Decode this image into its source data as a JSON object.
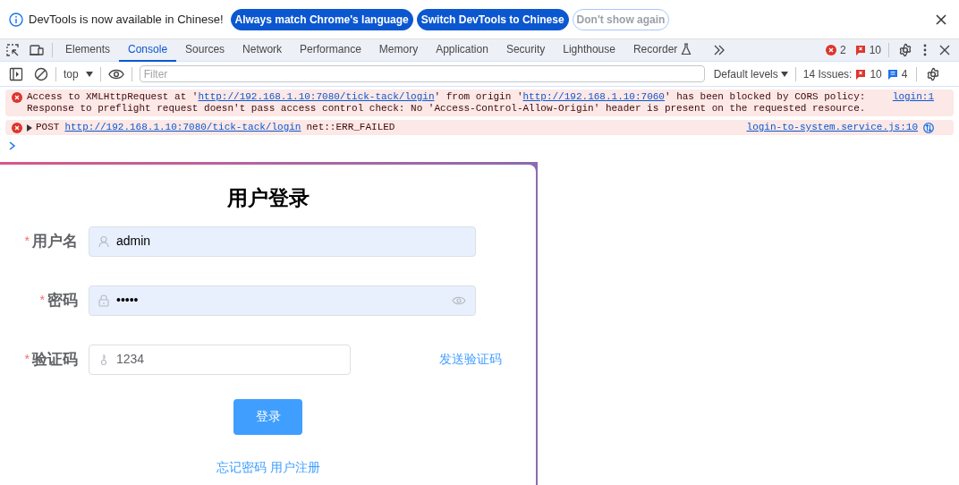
{
  "infobar": {
    "message": "DevTools is now available in Chinese!",
    "buttons": [
      {
        "label": "Always match Chrome's language",
        "kind": "primary"
      },
      {
        "label": "Switch DevTools to Chinese",
        "kind": "primary"
      },
      {
        "label": "Don't show again",
        "kind": "outline"
      }
    ]
  },
  "tabs": [
    {
      "label": "Elements",
      "selected": false
    },
    {
      "label": "Console",
      "selected": true
    },
    {
      "label": "Sources",
      "selected": false
    },
    {
      "label": "Network",
      "selected": false
    },
    {
      "label": "Performance",
      "selected": false
    },
    {
      "label": "Memory",
      "selected": false
    },
    {
      "label": "Application",
      "selected": false
    },
    {
      "label": "Security",
      "selected": false
    },
    {
      "label": "Lighthouse",
      "selected": false
    },
    {
      "label": "Recorder",
      "selected": false,
      "experimental": true
    }
  ],
  "error_count": "2",
  "issue_count": "10",
  "console_toolbar": {
    "context": "top",
    "filter_placeholder": "Filter",
    "levels": "Default levels",
    "issues_label": "14 Issues:",
    "issues_errors": "10",
    "issues_info": "4"
  },
  "messages": [
    {
      "kind": "cors",
      "lines": [
        [
          {
            "text": "Access to XMLHttpRequest at '"
          },
          {
            "text": "http://192.168.1.10:7080/tick-tack/login",
            "link": true
          },
          {
            "text": "' from origin '"
          },
          {
            "text": "http://192.168.1.10:7060",
            "link": true
          },
          {
            "text": "' has been blocked by CORS policy:"
          }
        ],
        [
          {
            "text": "Response to preflight request doesn't pass access control check: No 'Access-Control-Allow-Origin' header is present on the requested resource."
          }
        ]
      ],
      "source": "login:1"
    },
    {
      "kind": "request",
      "expanded": false,
      "method": "POST",
      "url": "http://192.168.1.10:7080/tick-tack/login",
      "status": "net::ERR_FAILED",
      "source": "login-to-system.service.js:10"
    }
  ],
  "login": {
    "title": "用户登录",
    "fields": [
      {
        "kind": "user",
        "label": "用户名",
        "required_mark": "*",
        "value": "admin",
        "autofilled": true
      },
      {
        "kind": "password",
        "label": "密码",
        "required_mark": "*",
        "value": "•••••",
        "autofilled": true
      },
      {
        "kind": "code",
        "label": "验证码",
        "required_mark": "*",
        "value": "1234",
        "autofilled": false,
        "action": "发送验证码"
      }
    ],
    "submit": "登录",
    "links": [
      "忘记密码",
      "用户注册"
    ]
  }
}
